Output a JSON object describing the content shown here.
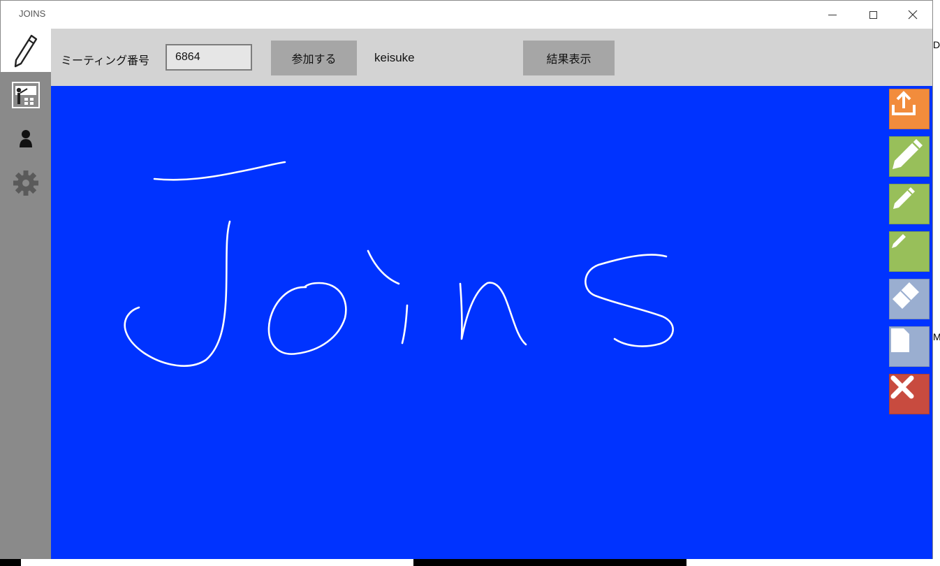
{
  "window": {
    "title": "JOINS"
  },
  "toolbar": {
    "meeting_label": "ミーティング番号",
    "meeting_number": "6864",
    "join_label": "参加する",
    "username": "keisuke",
    "results_label": "結果表示"
  },
  "canvas": {
    "background_color": "#0033ff",
    "ink_color": "#ffffff",
    "handwritten_text": "Joins"
  },
  "sidebar": {
    "items": [
      {
        "icon": "pencil-icon",
        "active": true
      },
      {
        "icon": "presentation-icon",
        "active": false
      },
      {
        "icon": "user-icon",
        "active": false
      },
      {
        "icon": "gear-icon",
        "active": false
      }
    ]
  },
  "tools": [
    {
      "icon": "upload-icon",
      "color": "#f28c3c"
    },
    {
      "icon": "pen-large-icon",
      "color": "#98bf5a"
    },
    {
      "icon": "pen-medium-icon",
      "color": "#98bf5a"
    },
    {
      "icon": "pen-small-icon",
      "color": "#98bf5a"
    },
    {
      "icon": "eraser-icon",
      "color": "#9aaed0"
    },
    {
      "icon": "page-icon",
      "color": "#9aaed0"
    },
    {
      "icon": "close-icon",
      "color": "#c84b3f"
    }
  ],
  "background_fragments": {
    "right_top": "De",
    "right_mid": "M"
  }
}
